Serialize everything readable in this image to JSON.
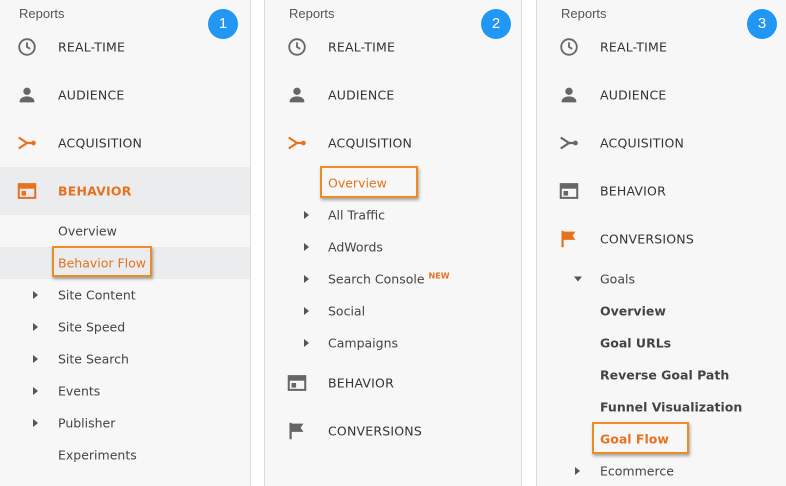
{
  "colors": {
    "accent": "#e8711f",
    "badge": "#2196f3",
    "highlight_border": "#f08a24"
  },
  "panel1": {
    "reports": "Reports",
    "badge": "1",
    "realtime": "REAL-TIME",
    "audience": "AUDIENCE",
    "acquisition": "ACQUISITION",
    "behavior": "BEHAVIOR",
    "items": {
      "overview": "Overview",
      "behavior_flow": "Behavior Flow",
      "site_content": "Site Content",
      "site_speed": "Site Speed",
      "site_search": "Site Search",
      "events": "Events",
      "publisher": "Publisher",
      "experiments": "Experiments"
    }
  },
  "panel2": {
    "reports": "Reports",
    "badge": "2",
    "realtime": "REAL-TIME",
    "audience": "AUDIENCE",
    "acquisition": "ACQUISITION",
    "items": {
      "overview": "Overview",
      "all_traffic": "All Traffic",
      "adwords": "AdWords",
      "search_console": "Search Console",
      "new_badge": "NEW",
      "social": "Social",
      "campaigns": "Campaigns"
    },
    "behavior": "BEHAVIOR",
    "conversions": "CONVERSIONS"
  },
  "panel3": {
    "reports": "Reports",
    "badge": "3",
    "realtime": "REAL-TIME",
    "audience": "AUDIENCE",
    "acquisition": "ACQUISITION",
    "behavior": "BEHAVIOR",
    "conversions": "CONVERSIONS",
    "items": {
      "goals": "Goals",
      "overview": "Overview",
      "goal_urls": "Goal URLs",
      "reverse_goal_path": "Reverse Goal Path",
      "funnel_visualization": "Funnel Visualization",
      "goal_flow": "Goal Flow",
      "ecommerce": "Ecommerce"
    }
  }
}
